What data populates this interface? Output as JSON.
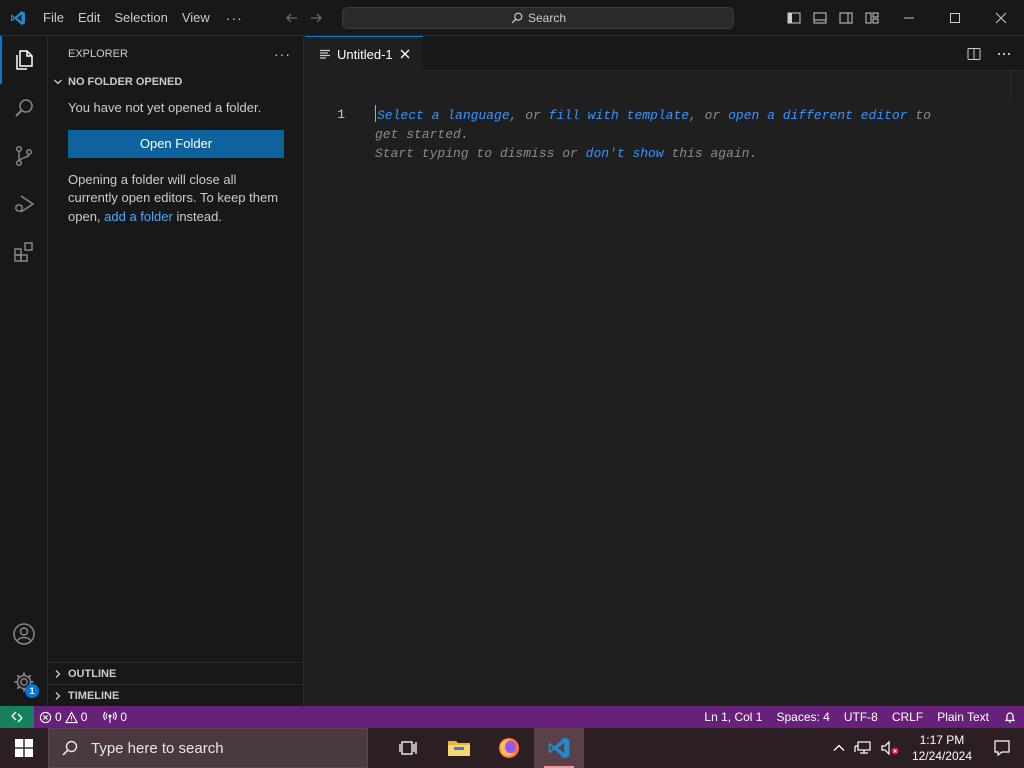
{
  "titlebar": {
    "menu": [
      "File",
      "Edit",
      "Selection",
      "View"
    ],
    "more": "···",
    "search_label": "Search"
  },
  "activitybar": {
    "items": [
      "explorer-icon",
      "search-icon",
      "source-control-icon",
      "run-debug-icon",
      "extensions-icon"
    ],
    "bottom": [
      "accounts-icon",
      "manage-gear-icon"
    ],
    "manage_badge": "1"
  },
  "sidebar": {
    "title": "EXPLORER",
    "more": "···",
    "section": "NO FOLDER OPENED",
    "message1": "You have not yet opened a folder.",
    "open_folder_label": "Open Folder",
    "message2_prefix": "Opening a folder will close all currently open editors. To keep them open, ",
    "message2_link": "add a folder",
    "message2_suffix": " instead.",
    "outline": "OUTLINE",
    "timeline": "TIMELINE"
  },
  "editor": {
    "tab_label": "Untitled-1",
    "line_number": "1",
    "hint": {
      "link1": "Select a language",
      "sep1": ", or ",
      "link2": "fill with template",
      "sep2": ", or ",
      "link3": "open a different editor",
      "tail1": " to get started.",
      "line2_prefix": "Start typing to dismiss or ",
      "link4": "don't show",
      "line2_suffix": " this again."
    }
  },
  "statusbar": {
    "errors": "0",
    "warnings": "0",
    "ports": "0",
    "position": "Ln 1, Col 1",
    "spaces": "Spaces: 4",
    "encoding": "UTF-8",
    "eol": "CRLF",
    "language": "Plain Text"
  },
  "taskbar": {
    "search_placeholder": "Type here to search",
    "time": "1:17 PM",
    "date": "12/24/2024"
  },
  "colors": {
    "accent": "#0078d4",
    "statusbar": "#68217a",
    "button": "#0e639c",
    "link": "#3794ff"
  }
}
